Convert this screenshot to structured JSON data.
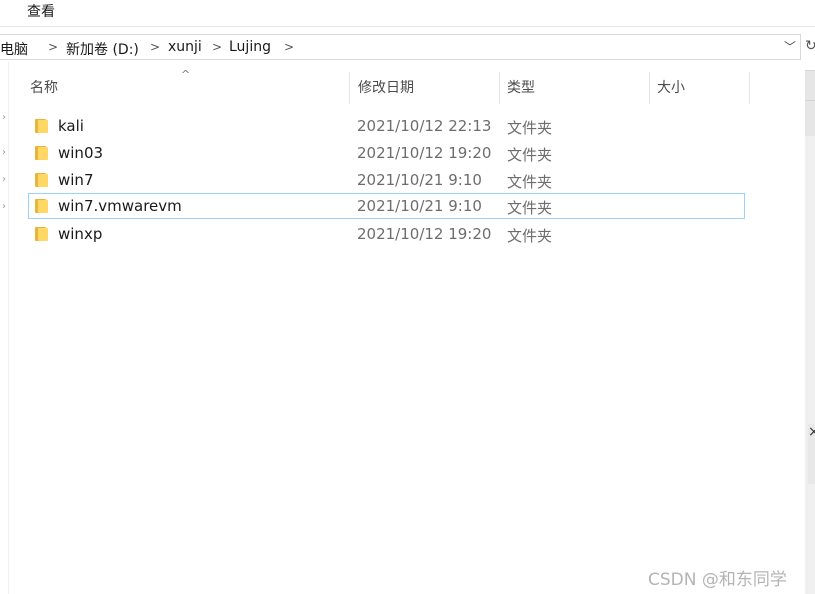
{
  "menu": {
    "view_label": "查看"
  },
  "breadcrumb": {
    "items": [
      "此电脑",
      "新加卷 (D:)",
      "xunji",
      "Lujing"
    ],
    "separator": ">",
    "dropdown": "﹀",
    "refresh": "↻"
  },
  "columns": {
    "name": "名称",
    "date": "修改日期",
    "type": "类型",
    "size": "大小",
    "sort_indicator": "^"
  },
  "files": [
    {
      "name": "kali",
      "date": "2021/10/12 22:13",
      "type": "文件夹"
    },
    {
      "name": "win03",
      "date": "2021/10/12 19:20",
      "type": "文件夹"
    },
    {
      "name": "win7",
      "date": "2021/10/21 9:10",
      "type": "文件夹"
    },
    {
      "name": "win7.vmwarevm",
      "date": "2021/10/21 9:10",
      "type": "文件夹"
    },
    {
      "name": "winxp",
      "date": "2021/10/12 19:20",
      "type": "文件夹"
    }
  ],
  "right_panel_glyph": "×",
  "watermark": "CSDN @和东同学",
  "colors": {
    "folder": "#ffd764",
    "focus_border": "#99d1ff",
    "muted_text": "#6d6d6d"
  }
}
